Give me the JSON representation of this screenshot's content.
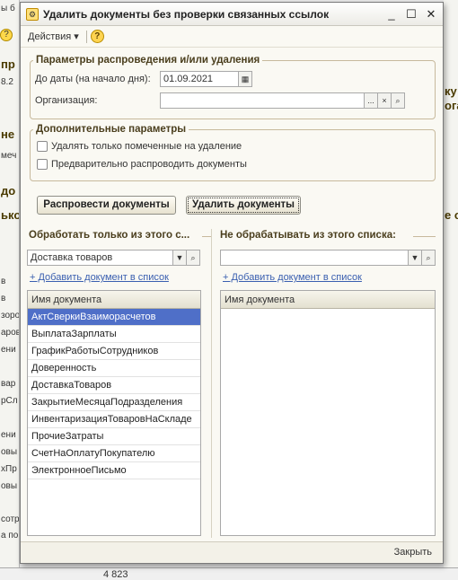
{
  "background": {
    "left_fragments": [
      "ы б",
      "пр",
      "8.2",
      "не",
      "меч",
      "до",
      "ько",
      "в",
      "в",
      "зоров",
      "аров",
      "ени",
      "вар",
      "рСл",
      "ени",
      "овы",
      "хПр",
      "овы",
      "сотр",
      "а по"
    ],
    "right_fragments": [
      "ку",
      "ога",
      "е о"
    ],
    "bottom_number": "4 823"
  },
  "window": {
    "title": "Удалить документы без проверки связанных ссылок",
    "min_label": "_",
    "max_label": "☐",
    "close_label": "✕"
  },
  "toolbar": {
    "actions_label": "Действия",
    "actions_caret": "▾",
    "help_label": "?"
  },
  "params": {
    "legend": "Параметры распроведения и/или удаления",
    "date_label": "До даты (на начало дня):",
    "date_value": "01.09.2021",
    "org_label": "Организация:",
    "org_value": "",
    "dots_label": "...",
    "clear_label": "×",
    "search_label": "🔍"
  },
  "extra": {
    "legend": "Дополнительные параметры",
    "cb_marked_label": "Удалять только помеченные на удаление",
    "cb_repost_label": "Предварительно распроводить документы"
  },
  "buttons": {
    "repost": "Распровести документы",
    "delete": "Удалить документы"
  },
  "left_panel": {
    "title": "Обработать только из этого с...",
    "select_value": "Доставка товаров",
    "add_link": "+ Добавить документ в список",
    "column": "Имя документа",
    "rows": [
      "АктСверкиВзаиморасчетов",
      "ВыплатаЗарплаты",
      "ГрафикРаботыСотрудников",
      "Доверенность",
      "ДоставкаТоваров",
      "ЗакрытиеМесяцаПодразделения",
      "ИнвентаризацияТоваровНаСкладе",
      "ПрочиеЗатраты",
      "СчетНаОплатуПокупателю",
      "ЭлектронноеПисьмо"
    ]
  },
  "right_panel": {
    "title": "Не обрабатывать из этого списка:",
    "select_value": "",
    "add_link": "+ Добавить документ в список",
    "column": "Имя документа"
  },
  "footer": {
    "close_label": "Закрыть"
  }
}
